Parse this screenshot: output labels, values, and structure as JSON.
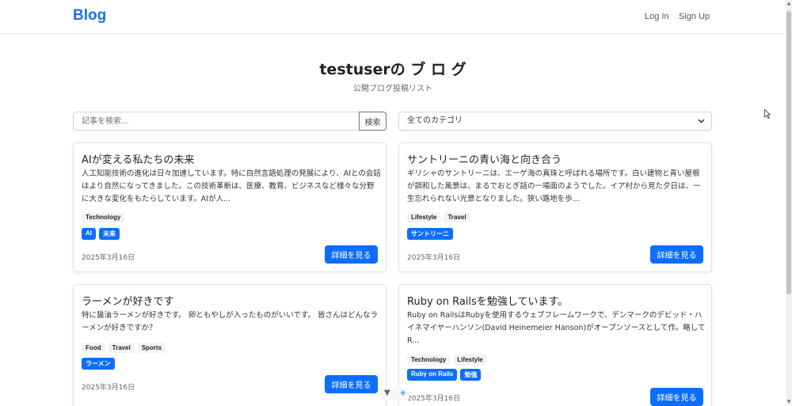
{
  "nav": {
    "brand": "Blog",
    "login": "Log In",
    "signup": "Sign Up"
  },
  "header": {
    "title": "testuserの ブ ロ グ",
    "subtitle": "公開ブログ投稿リスト"
  },
  "search": {
    "placeholder": "記事を検索...",
    "value": "",
    "button_label": "検索"
  },
  "category_filter": {
    "selected": "全てのカテゴリ",
    "icon": "chevron-down-icon"
  },
  "posts": [
    {
      "title": "AIが変える私たちの未来",
      "excerpt": "人工知能技術の進化は日々加速しています。特に自然言語処理の発展により、AIとの会話はより自然になってきました。この技術革新は、医療、教育、ビジネスなど様々な分野に大きな変化をもたらしています。AIが人...",
      "tags": [
        "Technology"
      ],
      "labels": [
        "AI",
        "未来"
      ],
      "date": "2025年3月16日",
      "button_label": "詳細を見る"
    },
    {
      "title": "サントリーニの青い海と向き合う",
      "excerpt": "ギリシャのサントリーニは、エーゲ海の真珠と呼ばれる場所です。白い建物と青い屋根が調和した風景は、まるでおとぎ話の一場面のようでした。イア村から見た夕日は、一生忘れられない光景となりました。狭い路地を歩...",
      "tags": [
        "Lifestyle",
        "Travel"
      ],
      "labels": [
        "サントリーニ"
      ],
      "date": "2025年3月16日",
      "button_label": "詳細を見る"
    },
    {
      "title": "ラーメンが好きです",
      "excerpt": "特に醤油ラーメンが好きです。 卵ともやしが入ったものがいいです。 皆さんはどんなラーメンが好きですか？",
      "tags": [
        "Food",
        "Travel",
        "Sports"
      ],
      "labels": [
        "ラーメン"
      ],
      "date": "2025年3月16日",
      "button_label": "詳細を見る"
    },
    {
      "title": "Ruby on Railsを勉強しています。",
      "excerpt": "Ruby on RailsはRubyを使用するウェブフレームワークで、デンマークのデビッド・ハイネマイヤーハンソン(David Heinemeier Hanson)がオープンソースとして作。略してR...",
      "tags": [
        "Technology",
        "Lifestyle"
      ],
      "labels": [
        "Ruby on Rails",
        "勉強"
      ],
      "date": "2025年3月16日",
      "button_label": "詳細を見る"
    }
  ],
  "colors": {
    "brand": "#1a73e8",
    "primary": "#0d6efd"
  }
}
